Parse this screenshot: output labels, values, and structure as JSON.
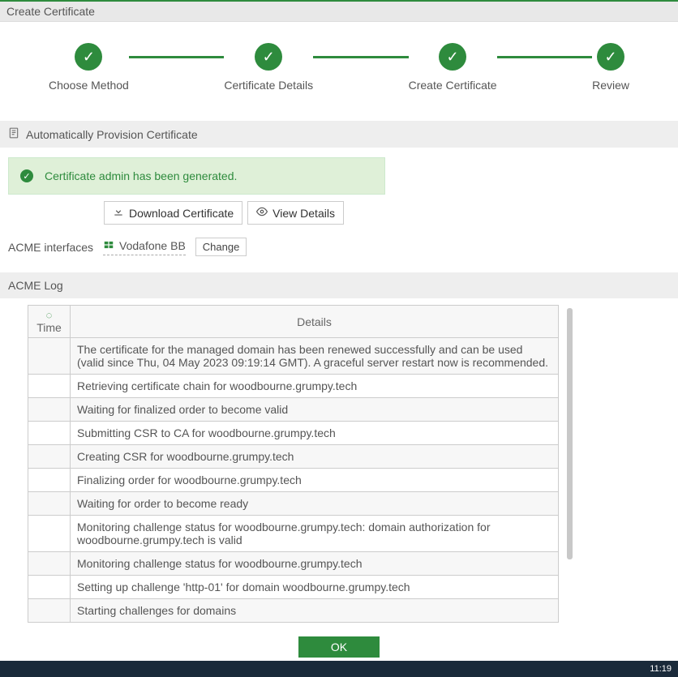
{
  "header": {
    "title": "Create Certificate"
  },
  "stepper": [
    {
      "label": "Choose Method"
    },
    {
      "label": "Certificate Details"
    },
    {
      "label": "Create Certificate"
    },
    {
      "label": "Review"
    }
  ],
  "section": {
    "title": "Automatically Provision Certificate"
  },
  "success": {
    "message": "Certificate admin has been generated."
  },
  "buttons": {
    "download": "Download Certificate",
    "view": "View Details",
    "change": "Change",
    "ok": "OK"
  },
  "acme_interface": {
    "label": "ACME interfaces",
    "value": "Vodafone BB"
  },
  "log": {
    "title": "ACME Log",
    "columns": {
      "time": "Time",
      "details": "Details"
    },
    "rows": [
      {
        "time": "",
        "details": "The certificate for the managed domain has been renewed successfully and can be used (valid since Thu, 04 May 2023 09:19:14 GMT). A graceful server restart now is recommended."
      },
      {
        "time": "",
        "details": "Retrieving certificate chain for woodbourne.grumpy.tech"
      },
      {
        "time": "",
        "details": "Waiting for finalized order to become valid"
      },
      {
        "time": "",
        "details": "Submitting CSR to CA for woodbourne.grumpy.tech"
      },
      {
        "time": "",
        "details": "Creating CSR for woodbourne.grumpy.tech"
      },
      {
        "time": "",
        "details": "Finalizing order for woodbourne.grumpy.tech"
      },
      {
        "time": "",
        "details": "Waiting for order to become ready"
      },
      {
        "time": "",
        "details": "Monitoring challenge status for woodbourne.grumpy.tech: domain authorization for woodbourne.grumpy.tech is valid"
      },
      {
        "time": "",
        "details": "Monitoring challenge status for woodbourne.grumpy.tech"
      },
      {
        "time": "",
        "details": "Setting up challenge 'http-01' for domain woodbourne.grumpy.tech"
      },
      {
        "time": "",
        "details": "Starting challenges for domains"
      }
    ]
  },
  "bottom": {
    "time": "11:19"
  }
}
